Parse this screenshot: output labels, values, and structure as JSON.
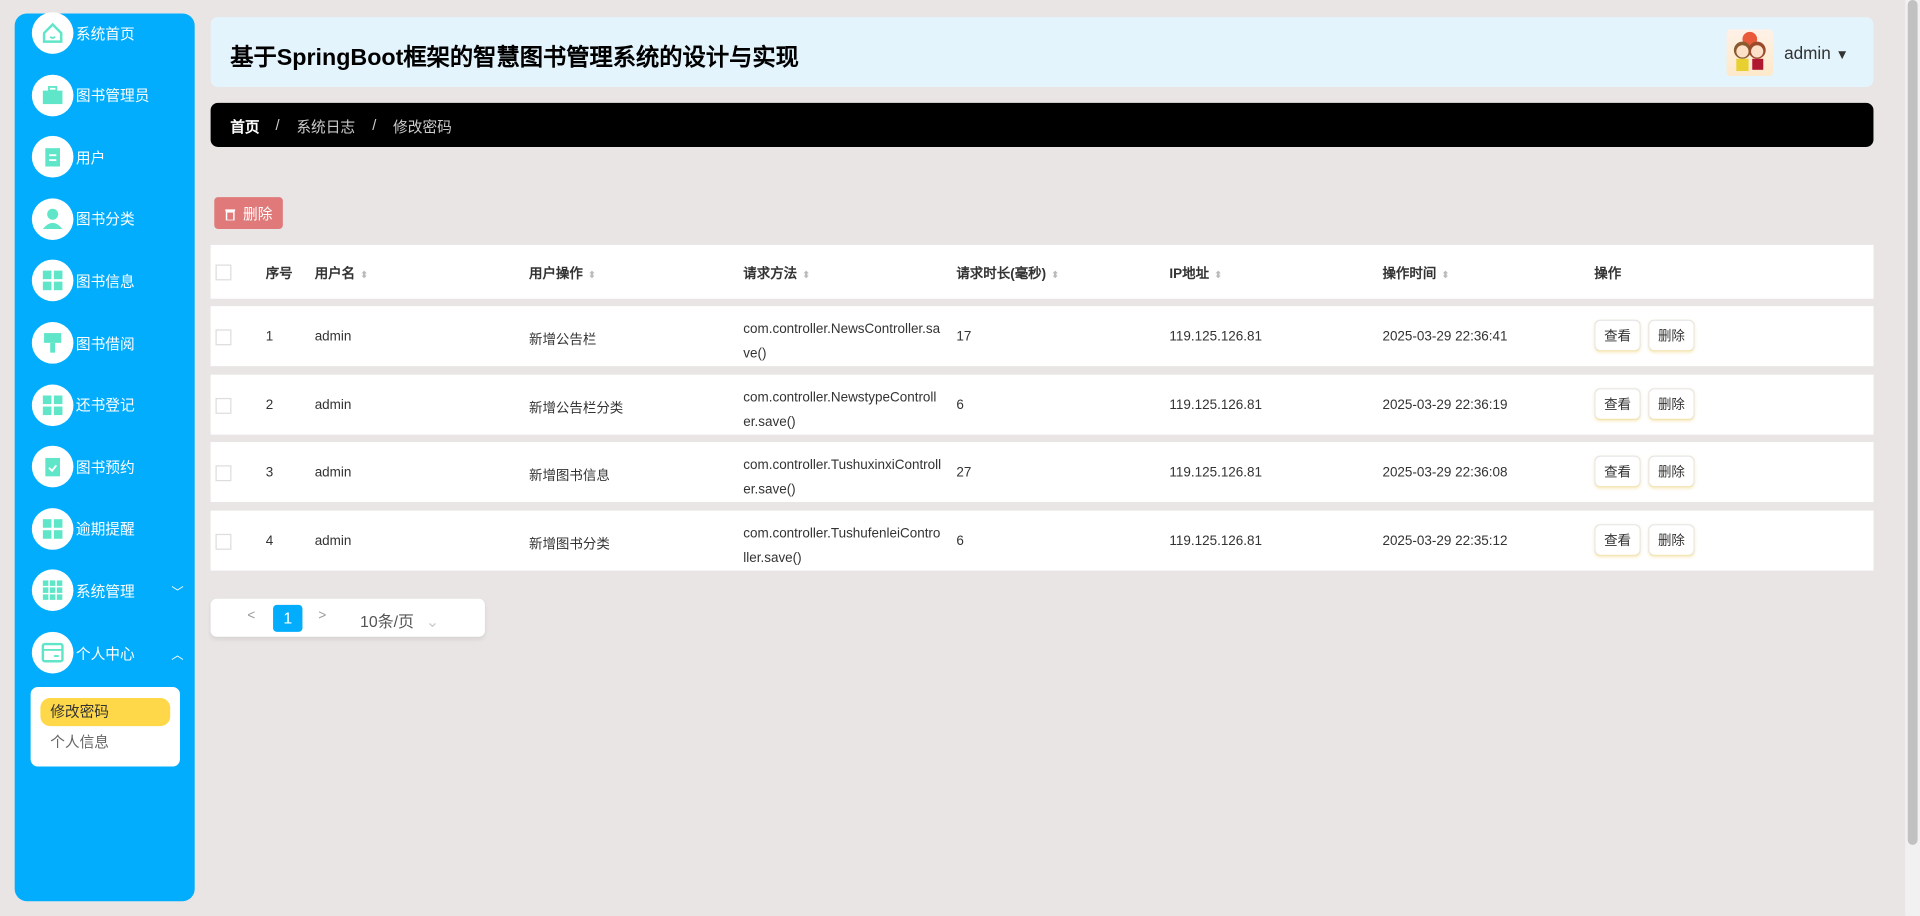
{
  "sidebar": {
    "items": [
      {
        "label": "系统首页",
        "icon": "home-icon"
      },
      {
        "label": "图书管理员",
        "icon": "briefcase-icon"
      },
      {
        "label": "用户",
        "icon": "clipboard-icon"
      },
      {
        "label": "图书分类",
        "icon": "user-icon"
      },
      {
        "label": "图书信息",
        "icon": "grid-icon"
      },
      {
        "label": "图书借阅",
        "icon": "pin-icon"
      },
      {
        "label": "还书登记",
        "icon": "grid-icon"
      },
      {
        "label": "图书预约",
        "icon": "clipboard-check-icon"
      },
      {
        "label": "逾期提醒",
        "icon": "grid-icon"
      },
      {
        "label": "系统管理",
        "icon": "grid9-icon",
        "chevron": "﹀"
      },
      {
        "label": "个人中心",
        "icon": "card-icon",
        "chevron": "︿"
      }
    ],
    "submenu": [
      {
        "label": "修改密码",
        "active": true
      },
      {
        "label": "个人信息",
        "active": false
      }
    ]
  },
  "header": {
    "title": "基于SpringBoot框架的智慧图书管理系统的设计与实现",
    "user": "admin",
    "caret": "▼"
  },
  "breadcrumb": [
    "首页",
    "系统日志",
    "修改密码"
  ],
  "breadcrumb_sep": "/",
  "toolbar": {
    "delete_label": "删除"
  },
  "table": {
    "columns": [
      "序号",
      "用户名",
      "用户操作",
      "请求方法",
      "请求时长(毫秒)",
      "IP地址",
      "操作时间",
      "操作"
    ],
    "rows": [
      {
        "no": "1",
        "user": "admin",
        "op": "新增公告栏",
        "method1": "com.controller.NewsController.sa",
        "method2": "ve()",
        "dur": "17",
        "ip": "119.125.126.81",
        "time": "2025-03-29 22:36:41"
      },
      {
        "no": "2",
        "user": "admin",
        "op": "新增公告栏分类",
        "method1": "com.controller.NewstypeControll",
        "method2": "er.save()",
        "dur": "6",
        "ip": "119.125.126.81",
        "time": "2025-03-29 22:36:19"
      },
      {
        "no": "3",
        "user": "admin",
        "op": "新增图书信息",
        "method1": "com.controller.TushuxinxiControll",
        "method2": "er.save()",
        "dur": "27",
        "ip": "119.125.126.81",
        "time": "2025-03-29 22:36:08"
      },
      {
        "no": "4",
        "user": "admin",
        "op": "新增图书分类",
        "method1": "com.controller.TushufenleiContro",
        "method2": "ller.save()",
        "dur": "6",
        "ip": "119.125.126.81",
        "time": "2025-03-29 22:35:12"
      }
    ],
    "view_label": "查看",
    "delete_label": "删除"
  },
  "pagination": {
    "prev": "<",
    "current": "1",
    "next": ">",
    "page_size": "10条/页",
    "caret": "⌄"
  },
  "colors": {
    "sidebar": "#03adfe",
    "icon": "#5fe6c8",
    "header": "#e3f4fd",
    "delete": "#e07a7a",
    "active": "#ffd84a"
  }
}
